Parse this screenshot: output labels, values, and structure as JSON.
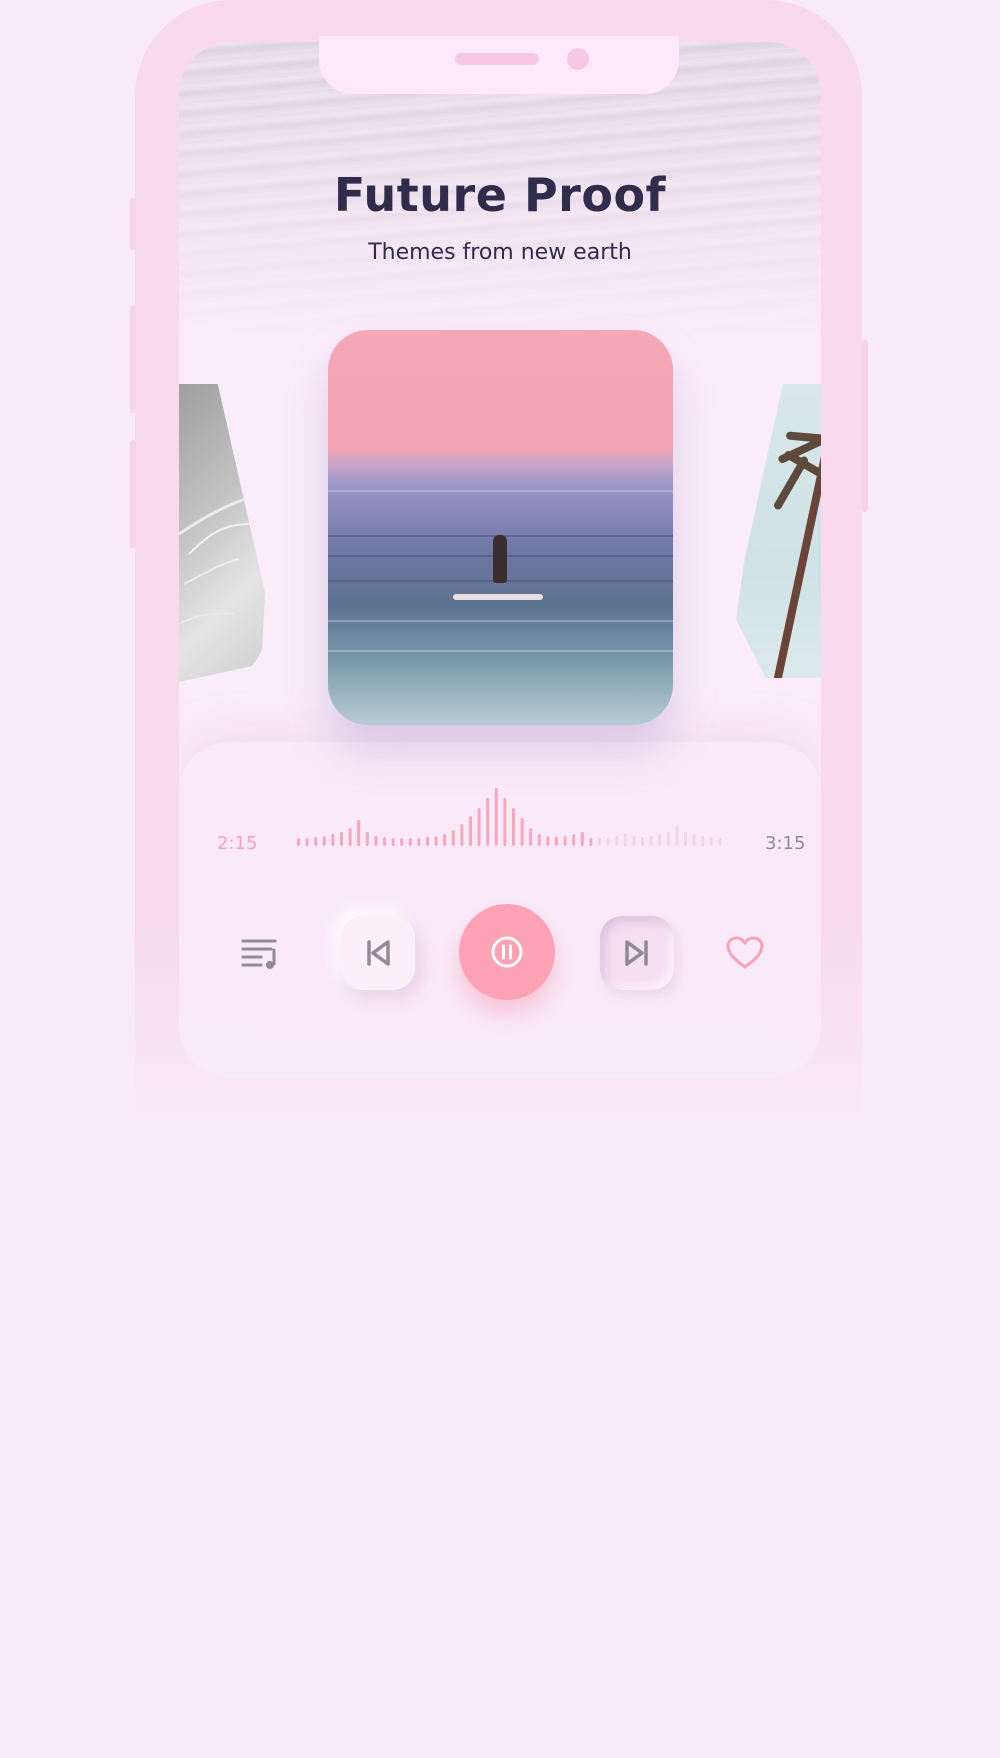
{
  "album": {
    "title": "Future Proof",
    "subtitle": "Themes from new earth"
  },
  "playback": {
    "elapsed": "2:15",
    "total": "3:15",
    "progress": 0.69,
    "state": "playing"
  },
  "controls": {
    "playlist_icon": "playlist-icon",
    "previous_icon": "skip-previous-icon",
    "pause_icon": "pause-icon",
    "next_icon": "skip-next-icon",
    "favorite_icon": "heart-icon"
  },
  "colors": {
    "accent": "#fca2b4",
    "waveform_played": "#f7a7b8",
    "waveform_unplayed": "#f3d6e6",
    "text_dark": "#2f2d4b",
    "background": "#f9eaf9"
  }
}
